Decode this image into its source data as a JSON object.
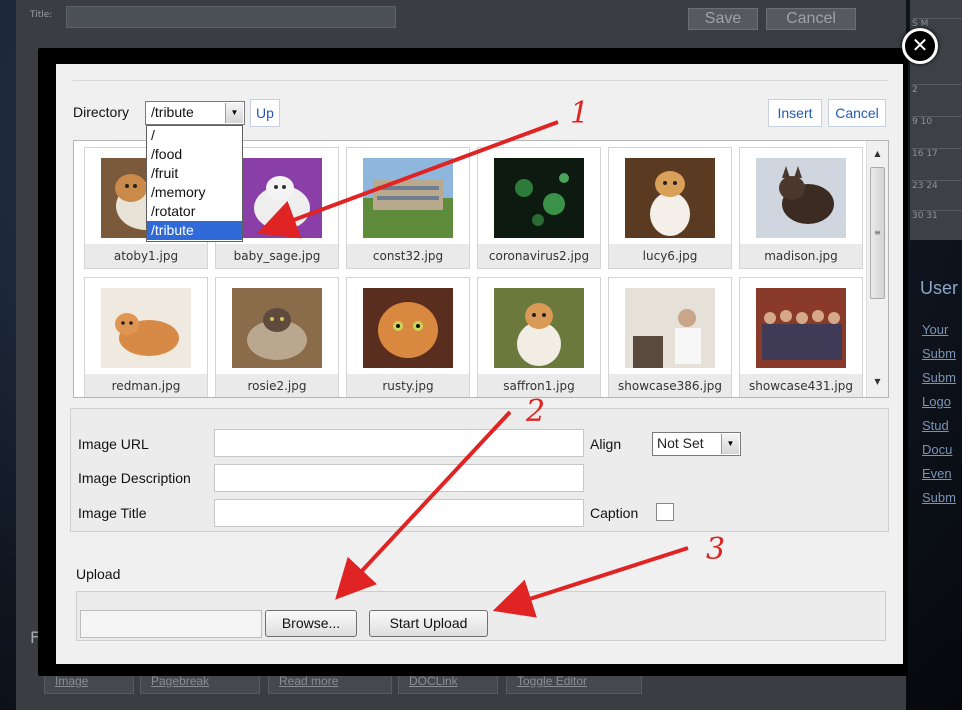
{
  "background": {
    "title_label": "Title:",
    "save_label": "Save",
    "cancel_label": "Cancel",
    "calendar_header": "S M",
    "calendar_rows": [
      "2",
      "9 10",
      "16 17",
      "23 24",
      "30 31"
    ],
    "side_heading": "User",
    "side_links": [
      "Your",
      "Subm",
      "Subm",
      "Logo",
      "Stud",
      "Docu",
      "Even",
      "Subm"
    ],
    "left_letter": "F",
    "bottom_buttons": [
      "Image",
      "Pagebreak",
      "Read more",
      "DOCLink",
      "Toggle Editor"
    ]
  },
  "toolbar": {
    "directory_label": "Directory",
    "directory_value": "/tribute",
    "up_label": "Up",
    "insert_label": "Insert",
    "cancel_label": "Cancel"
  },
  "directory_options": [
    "/",
    "/food",
    "/fruit",
    "/memory",
    "/rotator",
    "/tribute"
  ],
  "gallery": {
    "images": [
      {
        "name": "atoby1.jpg"
      },
      {
        "name": "baby_sage.jpg"
      },
      {
        "name": "const32.jpg"
      },
      {
        "name": "coronavirus2.jpg"
      },
      {
        "name": "lucy6.jpg"
      },
      {
        "name": "madison.jpg"
      },
      {
        "name": "redman.jpg"
      },
      {
        "name": "rosie2.jpg"
      },
      {
        "name": "rusty.jpg"
      },
      {
        "name": "saffron1.jpg"
      },
      {
        "name": "showcase386.jpg"
      },
      {
        "name": "showcase431.jpg"
      }
    ]
  },
  "properties": {
    "image_url_label": "Image URL",
    "image_description_label": "Image Description",
    "image_title_label": "Image Title",
    "align_label": "Align",
    "align_value": "Not Set",
    "caption_label": "Caption"
  },
  "upload": {
    "label": "Upload",
    "browse_label": "Browse...",
    "start_upload_label": "Start Upload"
  },
  "annotations": [
    "1",
    "2",
    "3"
  ],
  "colors": {
    "accent_link": "#2458b7",
    "selected_option": "#2f6ad8",
    "annotation": "#e02424"
  }
}
